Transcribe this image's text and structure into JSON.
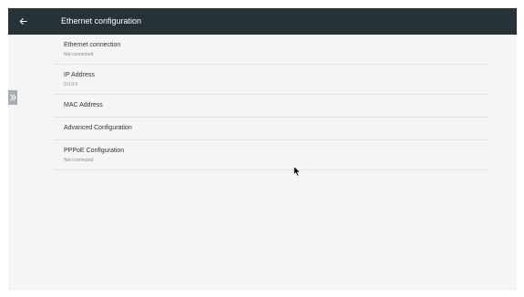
{
  "header": {
    "title": "Ethernet configuration"
  },
  "settings": {
    "items": [
      {
        "title": "Ethernet connection",
        "summary": "Not connected"
      },
      {
        "title": "IP Address",
        "summary": "0.0.0.0"
      },
      {
        "title": "MAC Address"
      },
      {
        "title": "Advanced Configuration"
      },
      {
        "title": "PPPoE Configuration",
        "summary": "Not connected"
      }
    ]
  },
  "colors": {
    "appbar": "#263238",
    "background": "#f5f5f5",
    "divider": "#e2e2e2",
    "side_handle": "#a7adb3"
  },
  "icons": {
    "back": "arrow-left-icon",
    "side_handle": "double-chevron-right-icon",
    "cursor": "mouse-pointer-icon"
  }
}
